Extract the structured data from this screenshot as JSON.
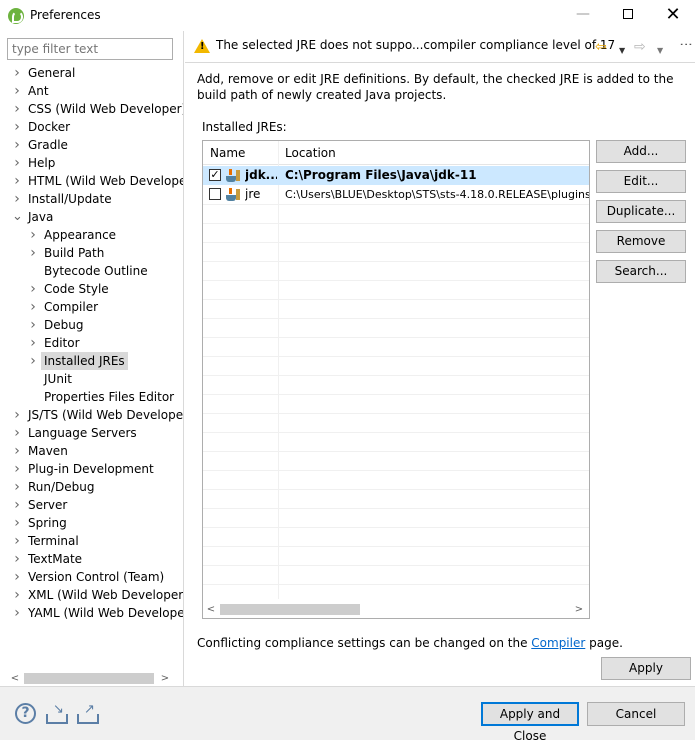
{
  "window": {
    "title": "Preferences",
    "min_glyph": "—",
    "close_glyph": "✕"
  },
  "filter": {
    "placeholder": "type filter text"
  },
  "tree": {
    "items": [
      {
        "label": "General",
        "expandable": true,
        "expanded": false,
        "level": 0
      },
      {
        "label": "Ant",
        "expandable": true,
        "expanded": false,
        "level": 0
      },
      {
        "label": "CSS (Wild Web Developer)",
        "expandable": true,
        "expanded": false,
        "level": 0
      },
      {
        "label": "Docker",
        "expandable": true,
        "expanded": false,
        "level": 0
      },
      {
        "label": "Gradle",
        "expandable": true,
        "expanded": false,
        "level": 0
      },
      {
        "label": "Help",
        "expandable": true,
        "expanded": false,
        "level": 0
      },
      {
        "label": "HTML (Wild Web Developer)",
        "expandable": true,
        "expanded": false,
        "level": 0
      },
      {
        "label": "Install/Update",
        "expandable": true,
        "expanded": false,
        "level": 0
      },
      {
        "label": "Java",
        "expandable": true,
        "expanded": true,
        "level": 0
      },
      {
        "label": "Appearance",
        "expandable": true,
        "expanded": false,
        "level": 1
      },
      {
        "label": "Build Path",
        "expandable": true,
        "expanded": false,
        "level": 1
      },
      {
        "label": "Bytecode Outline",
        "expandable": false,
        "expanded": false,
        "level": 1
      },
      {
        "label": "Code Style",
        "expandable": true,
        "expanded": false,
        "level": 1
      },
      {
        "label": "Compiler",
        "expandable": true,
        "expanded": false,
        "level": 1
      },
      {
        "label": "Debug",
        "expandable": true,
        "expanded": false,
        "level": 1
      },
      {
        "label": "Editor",
        "expandable": true,
        "expanded": false,
        "level": 1
      },
      {
        "label": "Installed JREs",
        "expandable": true,
        "expanded": false,
        "level": 1,
        "selected": true
      },
      {
        "label": "JUnit",
        "expandable": false,
        "expanded": false,
        "level": 1
      },
      {
        "label": "Properties Files Editor",
        "expandable": false,
        "expanded": false,
        "level": 1
      },
      {
        "label": "JS/TS (Wild Web Developer)",
        "expandable": true,
        "expanded": false,
        "level": 0
      },
      {
        "label": "Language Servers",
        "expandable": true,
        "expanded": false,
        "level": 0
      },
      {
        "label": "Maven",
        "expandable": true,
        "expanded": false,
        "level": 0
      },
      {
        "label": "Plug-in Development",
        "expandable": true,
        "expanded": false,
        "level": 0
      },
      {
        "label": "Run/Debug",
        "expandable": true,
        "expanded": false,
        "level": 0
      },
      {
        "label": "Server",
        "expandable": true,
        "expanded": false,
        "level": 0
      },
      {
        "label": "Spring",
        "expandable": true,
        "expanded": false,
        "level": 0
      },
      {
        "label": "Terminal",
        "expandable": true,
        "expanded": false,
        "level": 0
      },
      {
        "label": "TextMate",
        "expandable": true,
        "expanded": false,
        "level": 0
      },
      {
        "label": "Version Control (Team)",
        "expandable": true,
        "expanded": false,
        "level": 0
      },
      {
        "label": "XML (Wild Web Developer)",
        "expandable": true,
        "expanded": false,
        "level": 0
      },
      {
        "label": "YAML (Wild Web Developer)",
        "expandable": true,
        "expanded": false,
        "level": 0
      }
    ]
  },
  "message": {
    "text": "The selected JRE does not suppo...compiler compliance level of 17",
    "icon": "warning-icon"
  },
  "nav": {
    "back": "⇦",
    "forward": "⇨",
    "dropdown": "▼",
    "menu": "⋮"
  },
  "page": {
    "description": "Add, remove or edit JRE definitions. By default, the checked JRE is added to the build path of newly created Java projects.",
    "installed_label": "Installed JREs:",
    "columns": [
      "Name",
      "Location"
    ],
    "rows": [
      {
        "name": "jdk...",
        "location": "C:\\Program Files\\Java\\jdk-11",
        "checked": true,
        "selected": true
      },
      {
        "name": "jre",
        "location": "C:\\Users\\BLUE\\Desktop\\STS\\sts-4.18.0.RELEASE\\plugins",
        "checked": false,
        "selected": false
      }
    ],
    "buttons": {
      "add": "Add...",
      "edit": "Edit...",
      "duplicate": "Duplicate...",
      "remove": "Remove",
      "search": "Search..."
    },
    "conflict_prefix": "Conflicting compliance settings can be changed on the ",
    "conflict_link": "Compiler",
    "conflict_suffix": " page.",
    "apply": "Apply"
  },
  "footer": {
    "help_glyph": "?",
    "apply_and_close": "Apply and Close",
    "cancel": "Cancel"
  },
  "scroll": {
    "left": "<",
    "right": ">"
  },
  "colors": {
    "selection": "#cce8ff",
    "tree_selection": "#d9d9d9",
    "link": "#0066cc",
    "warning": "#f2b800",
    "spring_green": "#6db33f"
  }
}
